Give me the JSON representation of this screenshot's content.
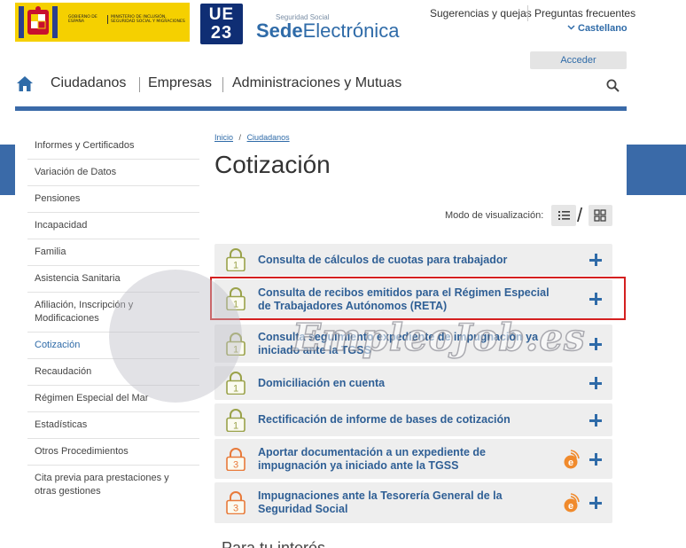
{
  "header": {
    "gov_logo": {
      "text_left": "GOBIERNO DE ESPAÑA",
      "text_right": "MINISTERIO DE INCLUSIÓN, SEGURIDAD SOCIAL Y MIGRACIONES"
    },
    "eu_logo": {
      "line1": "UE",
      "line2": "23"
    },
    "sede": {
      "small": "Seguridad Social",
      "strong": "Sede",
      "rest": "Electrónica"
    },
    "links": {
      "suggestions": "Sugerencias y quejas",
      "faq": "Preguntas frecuentes",
      "language": "Castellano"
    },
    "login_label": "Acceder"
  },
  "nav": {
    "items": [
      "Ciudadanos",
      "Empresas",
      "Administraciones y Mutuas"
    ]
  },
  "sidebar": {
    "items": [
      "Informes y Certificados",
      "Variación de Datos",
      "Pensiones",
      "Incapacidad",
      "Familia",
      "Asistencia Sanitaria",
      "Afiliación, Inscripción y Modificaciones",
      "Cotización",
      "Recaudación",
      "Régimen Especial del Mar",
      "Estadísticas",
      "Otros Procedimientos",
      "Cita previa para prestaciones y otras gestiones"
    ],
    "active": "Cotización"
  },
  "breadcrumb": {
    "home": "Inicio",
    "separator": "/",
    "current": "Ciudadanos"
  },
  "page_title": "Cotización",
  "view_mode_label": "Modo de visualización:",
  "procedures": [
    {
      "label": "Consulta de cálculos de cuotas para trabajador",
      "level": "1",
      "electronic": false
    },
    {
      "label": "Consulta de recibos emitidos para el Régimen Especial de Trabajadores Autónomos (RETA)",
      "level": "1",
      "electronic": false,
      "highlighted": true
    },
    {
      "label": "Consulta seguimiento expediente de impugnación ya iniciado ante la TGSS",
      "level": "1",
      "electronic": false
    },
    {
      "label": "Domiciliación en cuenta",
      "level": "1",
      "electronic": false
    },
    {
      "label": "Rectificación de informe de bases de cotización",
      "level": "1",
      "electronic": false
    },
    {
      "label": "Aportar documentación a un expediente de impugnación ya iniciado ante la TGSS",
      "level": "3",
      "electronic": true
    },
    {
      "label": "Impugnaciones ante la Tesorería General de la Seguridad Social",
      "level": "3",
      "electronic": true
    }
  ],
  "bottom_heading": "Para tu interés",
  "watermark": "EmpleoJob.es",
  "colors": {
    "brand_blue": "#3a6aa8",
    "link_blue": "#2f6ba8",
    "level1_green": "#9aa24a",
    "level3_orange": "#e87a3a",
    "highlight_red": "#d42020",
    "card_bg": "#eeeeee"
  }
}
